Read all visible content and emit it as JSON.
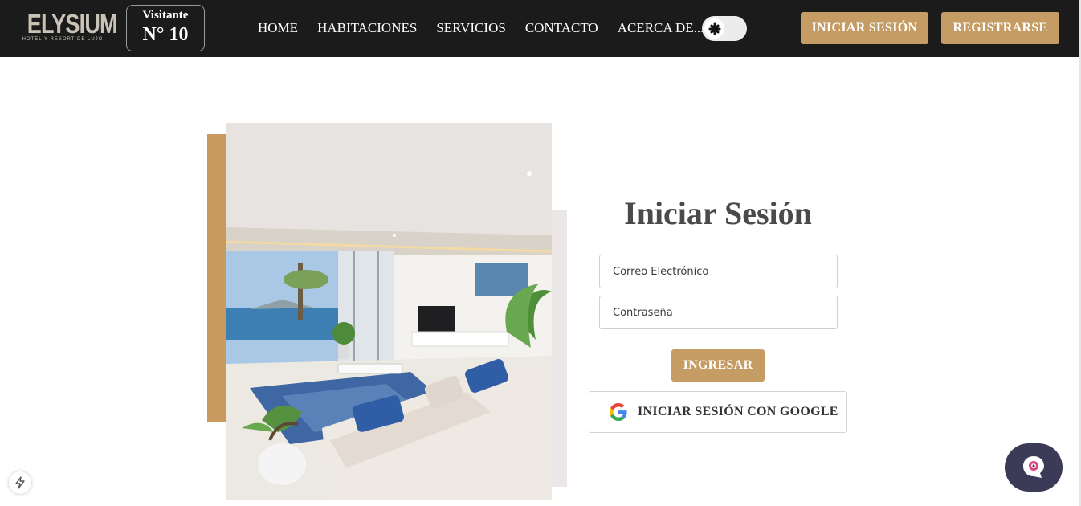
{
  "header": {
    "logo_main": "ELYSIUM",
    "logo_sub": "HOTEL Y RESORT DE LUJO",
    "visitor_label": "Visitante",
    "visitor_number": "N° 10",
    "nav": [
      {
        "label": "HOME"
      },
      {
        "label": "HABITACIONES"
      },
      {
        "label": "SERVICIOS"
      },
      {
        "label": "CONTACTO"
      },
      {
        "label": "ACERCA DE..."
      }
    ],
    "theme_toggle": {
      "icon": "sun-icon",
      "state": "light"
    },
    "login_button": "INICIAR SESIÓN",
    "register_button": "REGISTRARSE"
  },
  "login_form": {
    "title": "Iniciar Sesión",
    "email_placeholder": "Correo Electrónico",
    "email_value": "",
    "password_placeholder": "Contraseña",
    "password_value": "",
    "submit_label": "INGRESAR",
    "google_label": "INICIAR SESIÓN CON GOOGLE",
    "google_icon": "google-icon"
  },
  "decor": {
    "photo": "luxury-living-room-photo"
  },
  "widgets": {
    "dev_badge_icon": "bolt-icon",
    "chat_icon": "chat-bot-icon"
  },
  "colors": {
    "navbar_bg": "#1b1b1b",
    "accent_gold": "#c49c64",
    "title_text": "#4a4a4a",
    "chat_bg": "#3b3a57"
  }
}
